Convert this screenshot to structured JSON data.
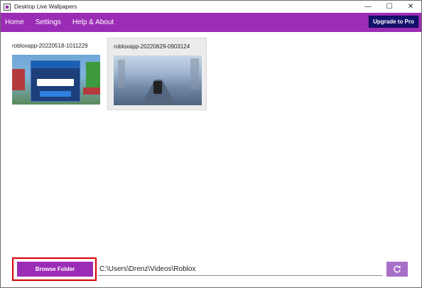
{
  "window": {
    "title": "Desktop Live Wallpapers",
    "controls": {
      "minimize": "—",
      "maximize": "☐",
      "close": "✕"
    }
  },
  "nav": {
    "items": [
      {
        "label": "Home"
      },
      {
        "label": "Settings"
      },
      {
        "label": "Help & About"
      }
    ],
    "upgrade_label": "Upgrade to Pro"
  },
  "wallpapers": [
    {
      "name": "robloxapp-20220518-1011229",
      "selected": false
    },
    {
      "name": "robloxapp-20220629-0903124",
      "selected": true
    }
  ],
  "bottom": {
    "browse_label": "Browse Folder",
    "path_value": "C:\\Users\\Drenz\\Videos\\Roblox",
    "refresh_icon": "refresh-icon"
  },
  "colors": {
    "accent": "#9b2cb5",
    "upgrade_bg": "#14126e",
    "highlight": "#d40000",
    "refresh_bg": "#a86fc8"
  }
}
